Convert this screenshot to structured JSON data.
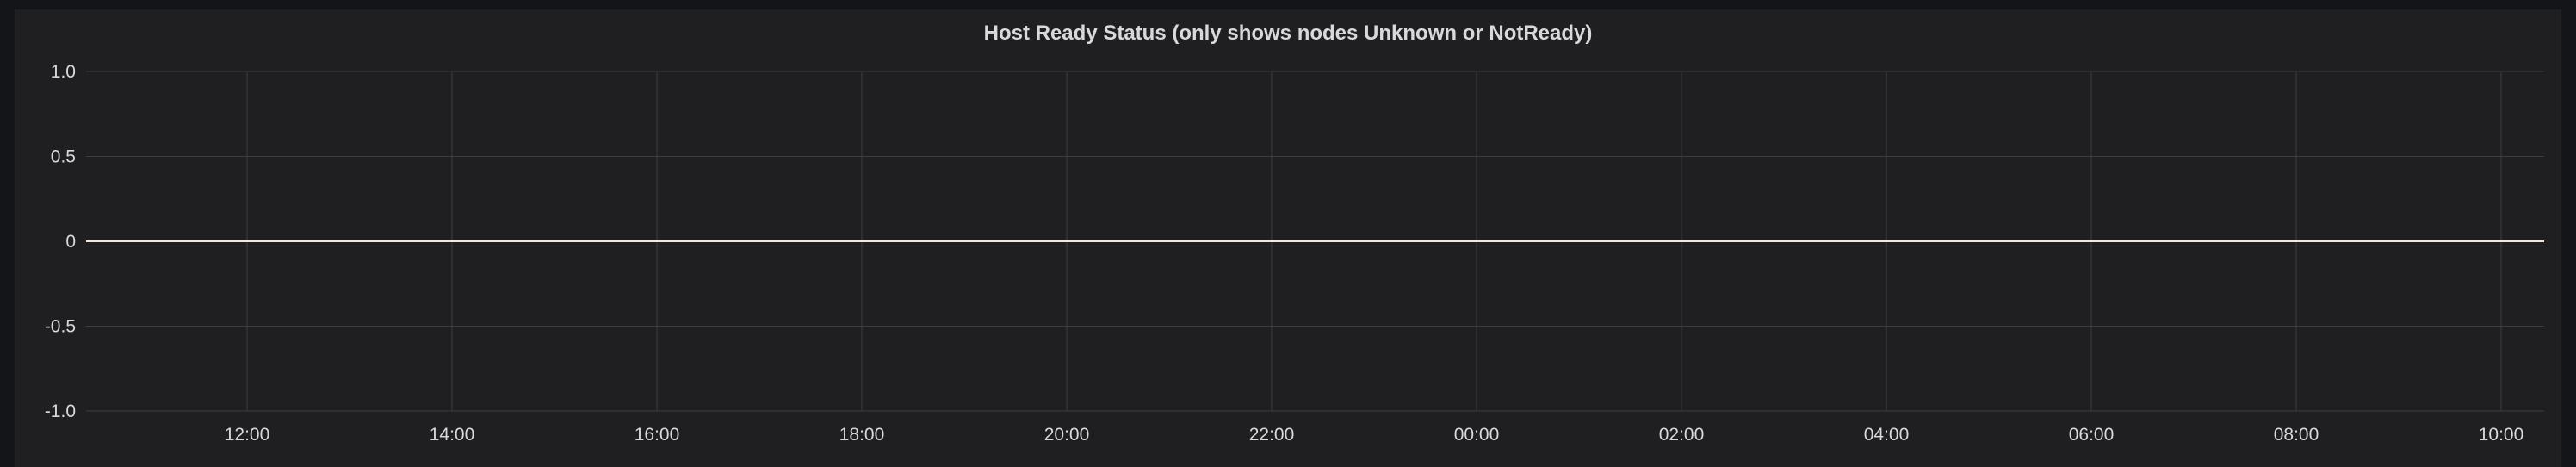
{
  "panel": {
    "title": "Host Ready Status (only shows nodes Unknown or NotReady)"
  },
  "colors": {
    "background": "#141518",
    "panel": "#1f1f22",
    "grid": "#3d3e42",
    "axis_text": "#d8d9da",
    "series": "#fce2de"
  },
  "chart_data": {
    "type": "line",
    "title": "Host Ready Status (only shows nodes Unknown or NotReady)",
    "xlabel": "",
    "ylabel": "",
    "x_ticks": [
      "12:00",
      "14:00",
      "16:00",
      "18:00",
      "20:00",
      "22:00",
      "00:00",
      "02:00",
      "04:00",
      "06:00",
      "08:00",
      "10:00"
    ],
    "y_ticks": [
      1.0,
      0.5,
      0,
      -0.5,
      -1.0
    ],
    "y_tick_labels": [
      "1.0",
      "0.5",
      "0",
      "-0.5",
      "-1.0"
    ],
    "ylim": [
      -1.0,
      1.0
    ],
    "grid": true,
    "legend": "none",
    "series": [
      {
        "values": [
          0,
          0,
          0,
          0,
          0,
          0,
          0,
          0,
          0,
          0,
          0,
          0
        ]
      }
    ]
  }
}
